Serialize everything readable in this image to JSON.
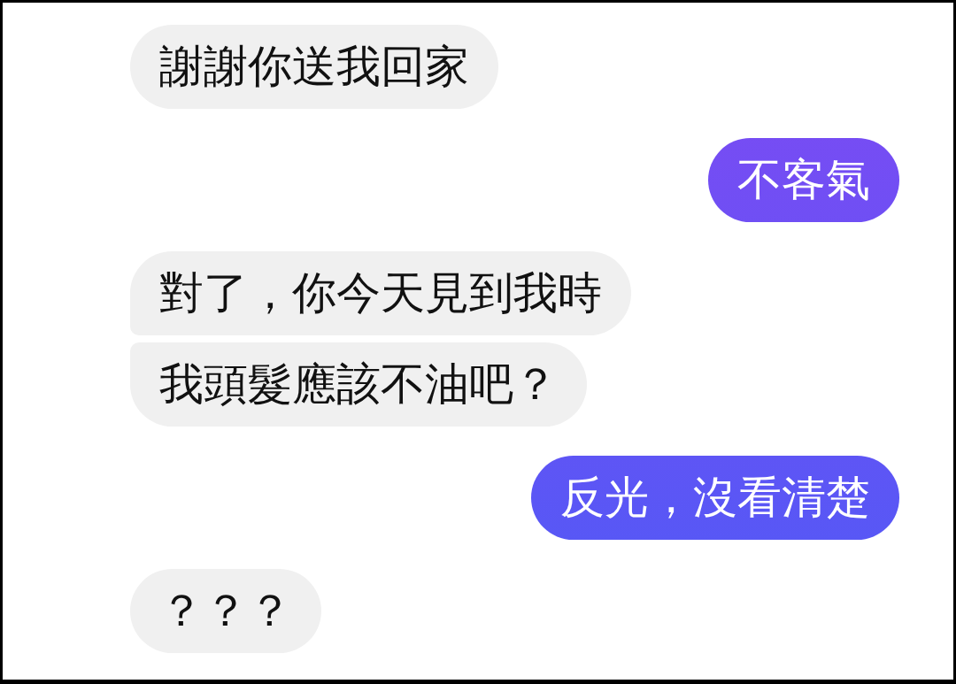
{
  "messages": [
    {
      "kind": "received",
      "text": "謝謝你送我回家"
    },
    {
      "kind": "sent",
      "text": "不客氣"
    },
    {
      "kind": "received",
      "text": "對了，你今天見到我時"
    },
    {
      "kind": "received",
      "text": "我頭髮應該不油吧？"
    },
    {
      "kind": "sent",
      "text": "反光，沒看清楚"
    },
    {
      "kind": "received",
      "text": "？？？"
    }
  ]
}
